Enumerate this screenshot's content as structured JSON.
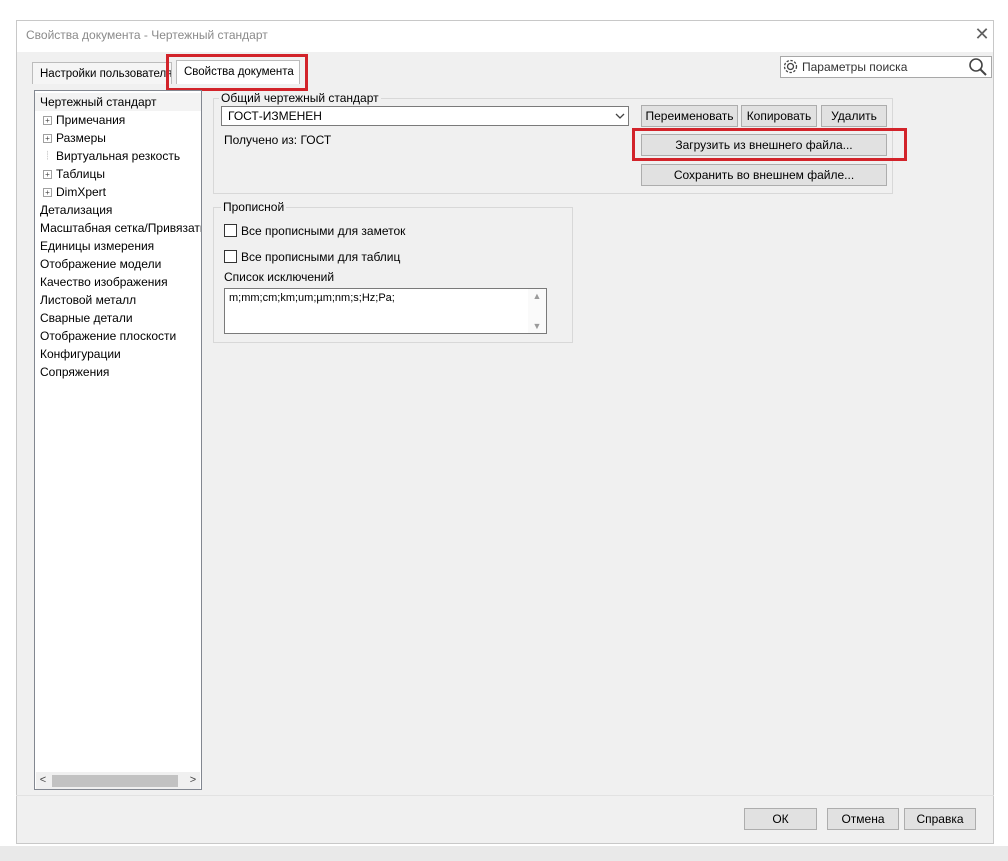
{
  "window": {
    "title": "Свойства документа - Чертежный стандарт",
    "close_glyph": "✕"
  },
  "tabs": [
    {
      "label": "Настройки пользователя",
      "active": false
    },
    {
      "label": "Свойства документа",
      "active": true
    }
  ],
  "search": {
    "label": "Параметры поиска",
    "icon": "gear-icon",
    "search_icon": "magnifier-icon"
  },
  "tree": {
    "items": [
      {
        "label": "Чертежный стандарт",
        "expandable": false,
        "selected": true
      },
      {
        "label": "Примечания",
        "expandable": true
      },
      {
        "label": "Размеры",
        "expandable": true
      },
      {
        "label": "Виртуальная резкость",
        "expandable": false
      },
      {
        "label": "Таблицы",
        "expandable": true
      },
      {
        "label": "DimXpert",
        "expandable": true
      },
      {
        "label": "Детализация",
        "expandable": false
      },
      {
        "label": "Масштабная сетка/Привязать",
        "expandable": false
      },
      {
        "label": "Единицы измерения",
        "expandable": false
      },
      {
        "label": "Отображение модели",
        "expandable": false
      },
      {
        "label": "Качество изображения",
        "expandable": false
      },
      {
        "label": "Листовой металл",
        "expandable": false
      },
      {
        "label": "Сварные детали",
        "expandable": false
      },
      {
        "label": "Отображение плоскости",
        "expandable": false
      },
      {
        "label": "Конфигурации",
        "expandable": false
      },
      {
        "label": "Сопряжения",
        "expandable": false
      }
    ],
    "scroll_left": "<",
    "scroll_right": ">"
  },
  "standard_group": {
    "legend": "Общий чертежный стандарт",
    "selected_value": "ГОСТ-ИЗМЕНЕН",
    "derived_from": "Получено из: ГОСТ",
    "buttons": {
      "rename": "Переименовать",
      "copy": "Копировать",
      "delete": "Удалить",
      "load": "Загрузить из внешнего файла...",
      "save": "Сохранить во внешнем файле..."
    }
  },
  "caps_group": {
    "legend": "Прописной",
    "checkbox_notes": {
      "label": "Все прописными для заметок",
      "checked": false
    },
    "checkbox_tables": {
      "label": "Все прописными для таблиц",
      "checked": false
    },
    "exceptions_label": "Список исключений",
    "exceptions_value": "m;mm;cm;km;um;µm;nm;s;Hz;Pa;"
  },
  "footer": {
    "ok": "ОК",
    "cancel": "Отмена",
    "help": "Справка"
  },
  "highlight_color": "#d2232a"
}
